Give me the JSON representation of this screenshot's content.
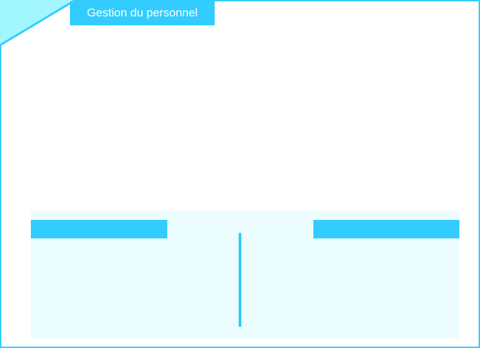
{
  "window": {
    "title": "Gestion du personnel"
  },
  "colors": {
    "accent": "#33ccff",
    "corner_light": "#a2f7ff",
    "panel_background": "#ebfdff",
    "background": "#ffffff"
  },
  "icons": {
    "corner": "corner-decoration"
  }
}
